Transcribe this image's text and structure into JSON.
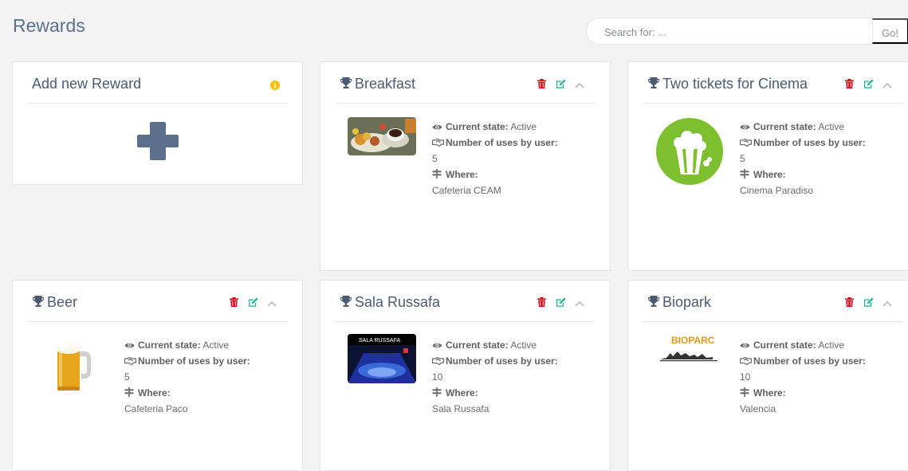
{
  "header": {
    "title": "Rewards",
    "search_placeholder": "Search for: ...",
    "go_label": "Go!"
  },
  "add_card": {
    "title": "Add new Reward"
  },
  "labels": {
    "state": "Current state:",
    "uses": "Number of uses by user:",
    "where": "Where:"
  },
  "rewards": [
    {
      "title": "Breakfast",
      "state": "Active",
      "uses": "5",
      "where": "Cafeteria CEAM",
      "image": "breakfast-photo"
    },
    {
      "title": "Two tickets for Cinema",
      "state": "Active",
      "uses": "5",
      "where": "Cinema Paradiso",
      "image": "popcorn-logo"
    },
    {
      "title": "Beer",
      "state": "Active",
      "uses": "5",
      "where": "Cafeteria Paco",
      "image": "beer-mug"
    },
    {
      "title": "Sala Russafa",
      "state": "Active",
      "uses": "10",
      "where": "Sala Russafa",
      "image": "theatre-photo"
    },
    {
      "title": "Biopark",
      "state": "Active",
      "uses": "10",
      "where": "Valencia",
      "image": "biopark-logo"
    }
  ],
  "colors": {
    "delete": "#e2001a",
    "edit": "#1ab394",
    "collapse": "#c2c2c2",
    "info": "#f8ac59",
    "plus": "#5b6f8c"
  }
}
